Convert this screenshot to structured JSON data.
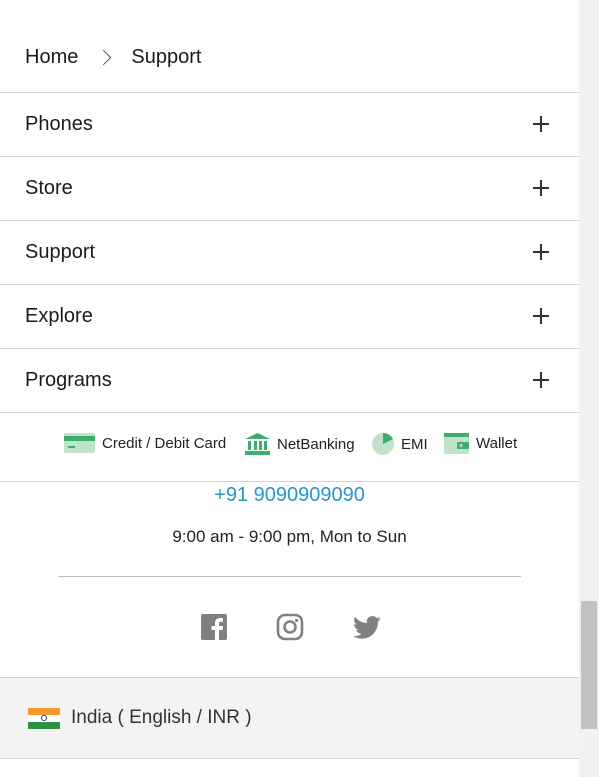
{
  "breadcrumb": {
    "home": "Home",
    "current": "Support"
  },
  "accordion": [
    {
      "label": "Phones"
    },
    {
      "label": "Store"
    },
    {
      "label": "Support"
    },
    {
      "label": "Explore"
    },
    {
      "label": "Programs"
    }
  ],
  "payments": {
    "card": "Credit / Debit Card",
    "netbanking": "NetBanking",
    "emi": "EMI",
    "wallet": "Wallet"
  },
  "contact": {
    "phone": "+91 9090909090",
    "hours": "9:00 am - 9:00 pm, Mon to Sun"
  },
  "social": [
    "facebook-icon",
    "instagram-icon",
    "twitter-icon"
  ],
  "locale": {
    "text": "India ( English / INR )"
  },
  "colors": {
    "accent_link": "#2b95c9",
    "payment_green": "#3dae6b",
    "icon_grey": "#808080"
  }
}
